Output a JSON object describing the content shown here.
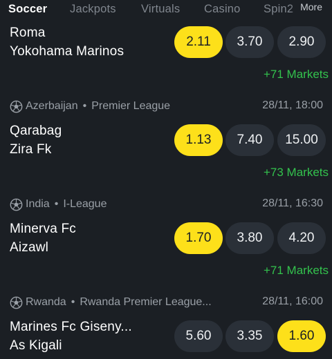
{
  "nav": {
    "tabs": [
      "Soccer",
      "Jackpots",
      "Virtuals",
      "Casino",
      "Spin2"
    ],
    "more": "More"
  },
  "matches": [
    {
      "country": "",
      "league": "",
      "datetime": "",
      "home": "Roma",
      "away": "Yokohama Marinos",
      "odds": [
        "2.11",
        "3.70",
        "2.90"
      ],
      "selected": 0,
      "markets": "+71 Markets"
    },
    {
      "country": "Azerbaijan",
      "separator": "•",
      "league": "Premier League",
      "datetime": "28/11, 18:00",
      "home": "Qarabag",
      "away": "Zira Fk",
      "odds": [
        "1.13",
        "7.40",
        "15.00"
      ],
      "selected": 0,
      "markets": "+73 Markets"
    },
    {
      "country": "India",
      "separator": "•",
      "league": "I-League",
      "datetime": "28/11, 16:30",
      "home": "Minerva Fc",
      "away": "Aizawl",
      "odds": [
        "1.70",
        "3.80",
        "4.20"
      ],
      "selected": 0,
      "markets": "+71 Markets"
    },
    {
      "country": "Rwanda",
      "separator": "•",
      "league": "Rwanda Premier League...",
      "datetime": "28/11, 16:00",
      "home": "Marines Fc Giseny...",
      "away": "As Kigali",
      "odds": [
        "5.60",
        "3.35",
        "1.60"
      ],
      "selected": 2,
      "markets": ""
    }
  ],
  "colors": {
    "background": "#1b1f24",
    "odd_button": "#2a3038",
    "selected_odd": "#fde01a",
    "markets_link": "#33c24d",
    "muted_text": "#9aa0a7"
  },
  "icons": {
    "sport": "soccer-ball-icon"
  }
}
